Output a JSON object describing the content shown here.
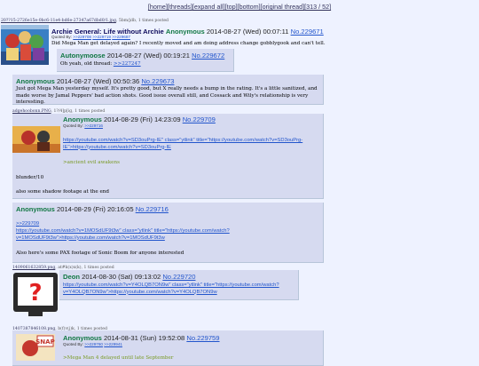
{
  "nav": {
    "home": "[home]",
    "threads": "[threads]",
    "expand": "[expand all]",
    "top": "[top]",
    "bottom": "[bottom]",
    "original": "[original thread]",
    "counter": "[313 / 52]"
  },
  "op": {
    "file_name": "20??15-2726e15e-0bc6-11e4-bd6e-27347a67dbd0/1.jpg",
    "file_info": ", 5bm/jdb, 1 times posted",
    "subject": "Archie General: Life without Archie",
    "name": "Anonymous",
    "date": "2014-08-27 (Wed) 00:07:11",
    "number": "No.229671",
    "quoted_by_label": "Quoted By:",
    "quoted_by": [
      ">>229708",
      ">>229719",
      ">>229687"
    ],
    "message": "Did Mega Man get delayed again? I recently moved and am doing address change gobblygook and can't tell."
  },
  "posts": [
    {
      "name": "Autonymoose",
      "date": "2014-08-27 (Wed) 00:19:21",
      "number": "No.229672",
      "lines": [
        {
          "text": "Oh yeah, old thread: "
        },
        {
          "link": ">>227247"
        }
      ]
    },
    {
      "name": "Anonymous",
      "date": "2014-08-27 (Wed) 00:50:36",
      "number": "No.229673",
      "lines": [
        {
          "text": "Just got Mega Man yesterday myself. It's pretty good, but X really needs a bump in the rating. It's a little sanitized, and made worse by Jamal Peppers' bad action shots. Good issue overall still, and Cossack and Wily's relationship is very interesting."
        }
      ]
    },
    {
      "file_name": "adgehoobonn.PNG",
      "file_info": ", 1?/4]p[ig, 1 times posted",
      "name": "Anonymous",
      "date": "2014-08-29 (Fri) 14:23:09",
      "number": "No.229709",
      "quoted_by_label": "Quoted By:",
      "quoted_by": [
        ">>229716"
      ],
      "message": "https://youtube.com/watch?v=SD3ouPrg-IE\" class=\"ytlink\" title=\"https://youtube.com/watch?v=SD3ouPrg-IE\">https://youtube.com/watch?v=SD3ouPrg-IE",
      "greentext": ">ancient evil awakens",
      "line2": "blunder/10",
      "line3": "also some shadow footage at the end"
    },
    {
      "name": "Anonymous",
      "date": "2014-08-29 (Fri) 20:16:05",
      "number": "No.229716",
      "backlink": ">>229709",
      "message": "https://youtube.com/watch?v=1MOSdUF9t3w\" class=\"ytlink\" title=\"https://youtube.com/watch?v=1MOSdUF9t3w\">https://youtube.com/watch?v=1MOSdUF9t3w",
      "line2": "Also here's some PAX footage of Sonic Boom for anyone interested"
    },
    {
      "file_name": "1409061632859.png",
      "file_info": ", at#k(x)x(k), 1 times posted",
      "name": "Deon",
      "date": "2014-08-30 (Sat) 09:13:02",
      "number": "No.229720",
      "message": "https://youtube.com/watch?v=Y4OLQB7ON9w\" class=\"ytlink\" title=\"https://youtube.com/watch?v=Y4OLQB7ON9w\">https://youtube.com/watch?v=Y4OLQB7ON9w"
    },
    {
      "file_name": "1407387846108.png",
      "file_info": ", b(f)v(j)k, 1 times posted",
      "name": "Anonymous",
      "date": "2014-08-31 (Sun) 19:52:08",
      "number": "No.229759",
      "quoted_by_label": "Quoted By:",
      "quoted_by": [
        ">>229760",
        ">>229941"
      ],
      "greentext": ">Mega Man 4 delayed until late September"
    }
  ],
  "colors": {
    "background": "#eef2ff",
    "reply": "#d6daf0",
    "subject": "#0f0c5d",
    "name": "#117743",
    "link": "#2255cc",
    "quote": "#789922"
  }
}
